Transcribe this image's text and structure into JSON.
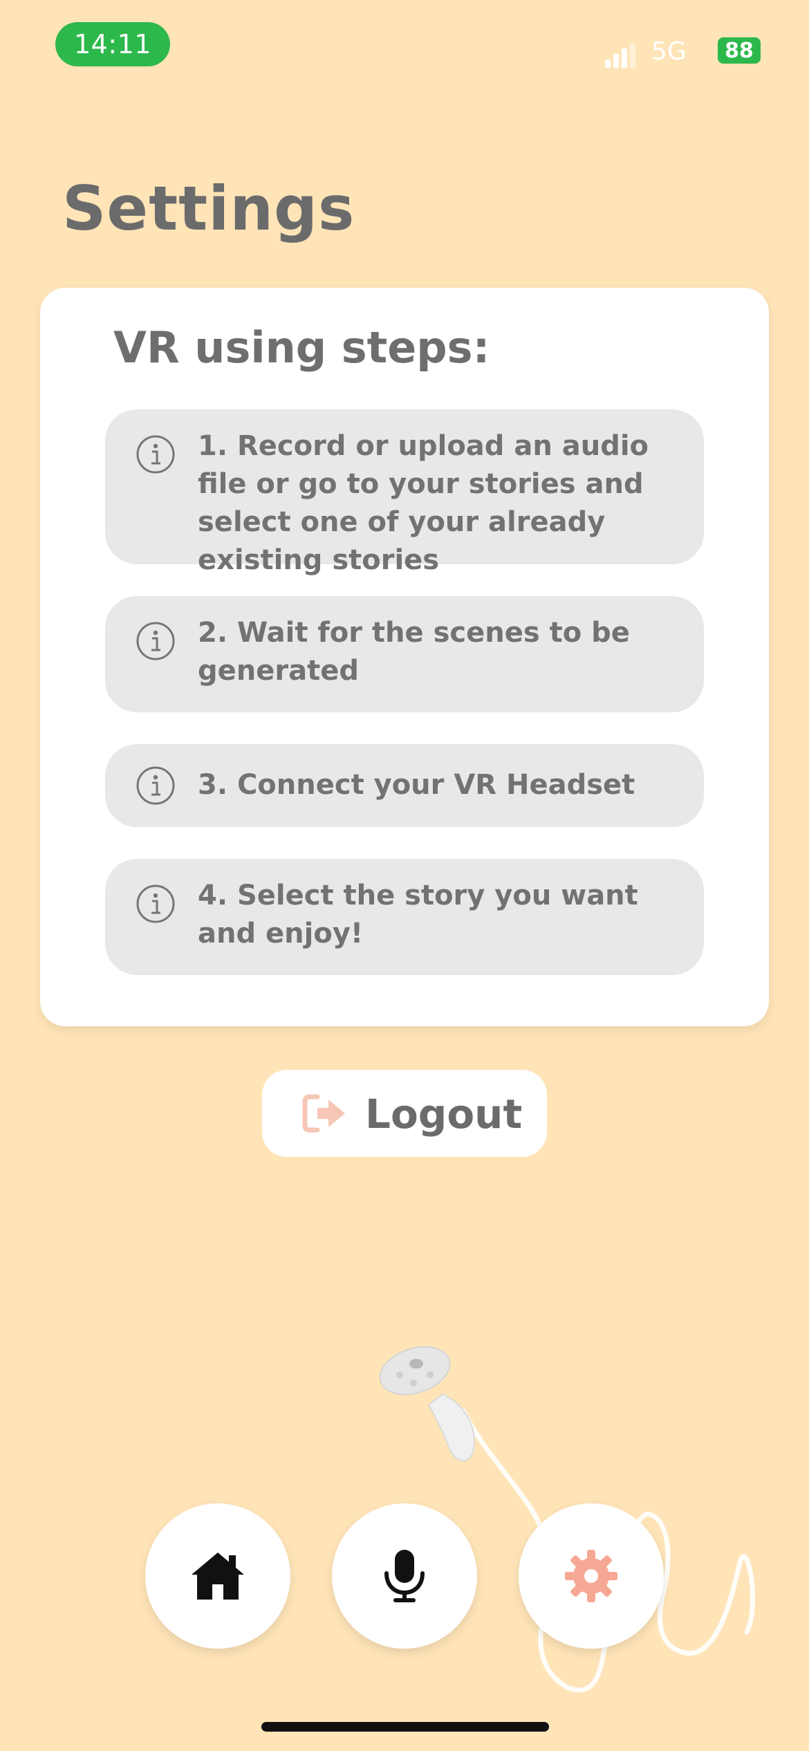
{
  "status_bar": {
    "time": "14:11",
    "network": "5G",
    "battery": "88"
  },
  "page": {
    "title": "Settings"
  },
  "steps_card": {
    "heading": "VR using steps:",
    "steps": [
      {
        "text": "1. Record or upload an audio file or go to your stories and select one of your already existing stories",
        "icon": "info-icon"
      },
      {
        "text": "2. Wait for the scenes to be generated",
        "icon": "info-icon"
      },
      {
        "text": "3. Connect your VR Headset",
        "icon": "info-icon"
      },
      {
        "text": "4. Select the story you want and enjoy!",
        "icon": "info-icon"
      }
    ]
  },
  "logout": {
    "label": "Logout",
    "icon": "logout-icon",
    "icon_color": "#F6C7B6"
  },
  "bottom_nav": {
    "items": [
      {
        "name": "home",
        "icon": "home-icon",
        "active": false
      },
      {
        "name": "record",
        "icon": "microphone-icon",
        "active": false
      },
      {
        "name": "settings",
        "icon": "gear-icon",
        "active": true
      }
    ]
  },
  "colors": {
    "background": "#FFE4B8",
    "card": "#FFFFFF",
    "step_background": "#E8E8E8",
    "text": "#6E6E6E",
    "active_accent": "#F6A894",
    "status_green": "#2DB84B"
  }
}
